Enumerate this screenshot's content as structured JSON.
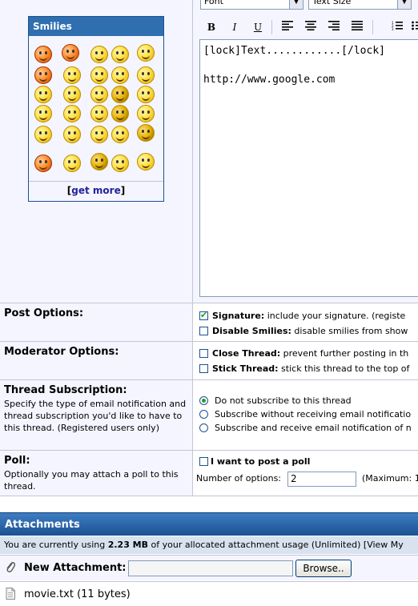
{
  "smilies": {
    "title": "Smilies",
    "get_more_open": "[",
    "get_more_label": "get more",
    "get_more_close": "]"
  },
  "editor": {
    "font_select": "Font",
    "size_select": "Text Size",
    "toolbar": {
      "bold": "B",
      "italic": "I",
      "underline": "U"
    },
    "content": "[lock]Text............[/lock]\n\nhttp://www.google.com"
  },
  "post_options": {
    "title": "Post Options:",
    "signature_label": "Signature:",
    "signature_desc": "include your signature. (registe",
    "smilies_label": "Disable Smilies:",
    "smilies_desc": "disable smilies from show"
  },
  "moderator_options": {
    "title": "Moderator Options:",
    "close_label": "Close Thread:",
    "close_desc": "prevent further posting in th",
    "stick_label": "Stick Thread:",
    "stick_desc": "stick this thread to the top of"
  },
  "subscription": {
    "title": "Thread Subscription:",
    "desc": "Specify the type of email notification and thread subscription you'd like to have to this thread. (Registered users only)",
    "options": [
      "Do not subscribe to this thread",
      "Subscribe without receiving email notificatio",
      "Subscribe and receive email notification of n"
    ]
  },
  "poll": {
    "title": "Poll:",
    "desc": "Optionally you may attach a poll to this thread.",
    "checkbox_label": "I want to post a poll",
    "options_label": "Number of options:",
    "options_value": "2",
    "maximum": "(Maximum: 1"
  },
  "attachments": {
    "title": "Attachments",
    "usage_prefix": "You are currently using ",
    "usage_amount": "2.23 MB",
    "usage_suffix": " of your allocated attachment usage (Unlimited) [View My",
    "new_label": "New Attachment:",
    "browse": "Browse..",
    "file": "movie.txt (11 bytes)"
  }
}
